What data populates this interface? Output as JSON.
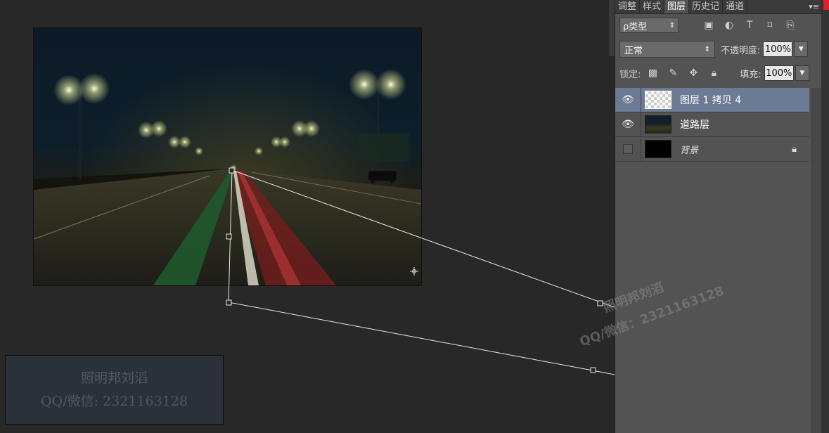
{
  "layers_panel": {
    "tabs": [
      {
        "label": "调整",
        "active": false
      },
      {
        "label": "样式",
        "active": false
      },
      {
        "label": "图层",
        "active": true
      },
      {
        "label": "历史记",
        "active": false
      },
      {
        "label": "通道",
        "active": false
      }
    ],
    "menu_icon": "panel-menu-icon",
    "filter": {
      "label": "ρ类型",
      "icons": [
        "image-filter-icon",
        "adjustment-filter-icon",
        "type-filter-icon",
        "shape-filter-icon",
        "smart-object-filter-icon"
      ]
    },
    "blend_mode": "正常",
    "opacity_label": "不透明度:",
    "opacity_value": "100%",
    "lock_label": "锁定:",
    "fill_label": "填充:",
    "fill_value": "100%",
    "layers": [
      {
        "name": "图层 1 拷贝 4",
        "visible": true,
        "selected": true,
        "thumb": "transparent"
      },
      {
        "name": "道路层",
        "visible": true,
        "selected": false,
        "thumb": "night"
      },
      {
        "name": "背景",
        "visible": false,
        "selected": false,
        "thumb": "black",
        "locked": true
      }
    ]
  },
  "watermark": {
    "line1": "照明邦刘滔",
    "line2": "QQ/微信: 2321163128"
  },
  "watermark_diagonal": {
    "line1": "照明邦刘滔",
    "line2": "QQ/微信：2321163128"
  },
  "colors": {
    "canvas_bg": "#282828",
    "panel_bg": "#535353",
    "selected_layer": "#6b7b93"
  }
}
